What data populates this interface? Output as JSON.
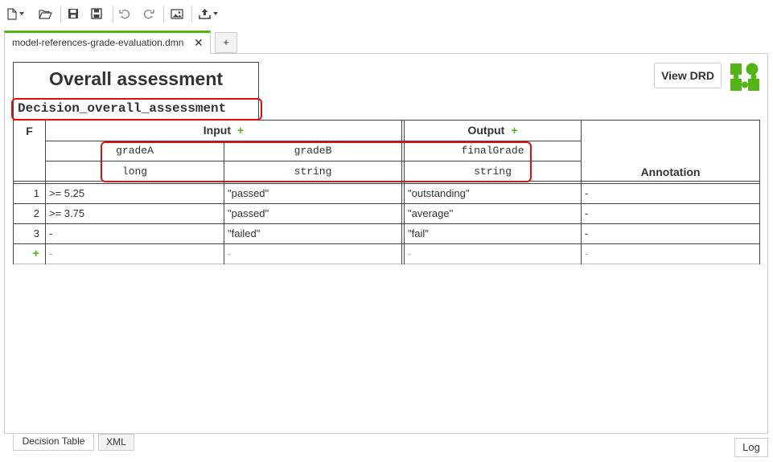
{
  "toolbar": {
    "items": [
      "new-file",
      "open-folder",
      "save",
      "save-as",
      "undo",
      "redo",
      "insert-image",
      "export"
    ]
  },
  "tabs": {
    "active_label": "model-references-grade-evaluation.dmn",
    "close_glyph": "✕",
    "add_glyph": "+"
  },
  "decision": {
    "name": "Overall assessment",
    "id": "Decision_overall_assessment"
  },
  "view_drd_label": "View DRD",
  "table": {
    "hit_policy": "F",
    "input_title": "Input",
    "output_title": "Output",
    "plus_glyph": "+",
    "annotation_title": "Annotation",
    "columns": [
      {
        "name": "gradeA",
        "type": "long"
      },
      {
        "name": "gradeB",
        "type": "string"
      },
      {
        "name": "finalGrade",
        "type": "string"
      }
    ],
    "rows": [
      {
        "num": "1",
        "gradeA": ">= 5.25",
        "gradeB": "\"passed\"",
        "finalGrade": "\"outstanding\"",
        "annotation": "-"
      },
      {
        "num": "2",
        "gradeA": ">= 3.75",
        "gradeB": "\"passed\"",
        "finalGrade": "\"average\"",
        "annotation": "-"
      },
      {
        "num": "3",
        "gradeA": "-",
        "gradeB": "\"failed\"",
        "finalGrade": "\"fail\"",
        "annotation": "-"
      }
    ],
    "add_row": {
      "glyph": "+",
      "gradeA": "-",
      "gradeB": "-",
      "finalGrade": "-",
      "annotation": "-"
    }
  },
  "bottom_tabs": [
    "Decision Table",
    "XML"
  ],
  "log_label": "Log",
  "colors": {
    "accent": "#52b415",
    "highlight": "#e01010",
    "border": "#444444"
  }
}
